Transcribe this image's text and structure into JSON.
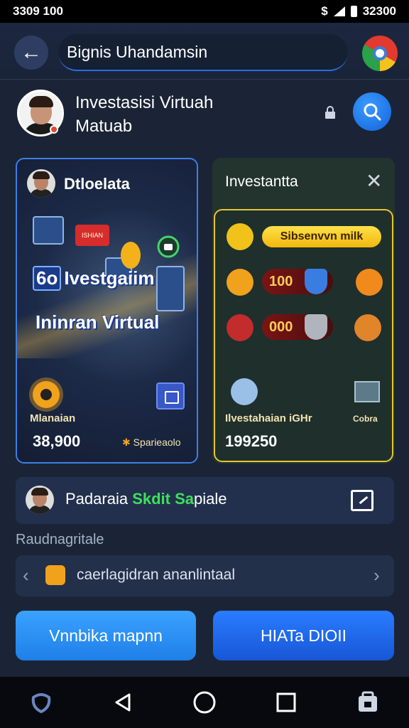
{
  "status_bar": {
    "time": "3309 100",
    "right_text": "32300"
  },
  "header": {
    "title": "Bignis Uhandamsin",
    "back_icon": "arrow-left-icon",
    "browser_icon": "chrome-icon"
  },
  "profile": {
    "title": "Investasisi Virtuah Matuab",
    "lock_icon": "lock-icon",
    "search_icon": "search-icon"
  },
  "card_left": {
    "title": "Dtloelata",
    "tag_text": "ISHIAN",
    "promo_line1": "Ivestgaiim",
    "promo_prefix": "6o",
    "promo_line2": "Ininran Virtual",
    "label": "Mlanaian",
    "value": "38,900",
    "secondary": "Sparieaolo"
  },
  "card_right": {
    "title": "Investantta",
    "pill_text": "Sibsenvvn milk",
    "row2_value": "100",
    "row3_value": "000",
    "label": "Ilvestahaian iGHr",
    "side_label": "Cobra",
    "value": "199250"
  },
  "promo": {
    "prefix": "Padaraia",
    "green_text": "Skdit",
    "green_text2": "Sa",
    "suffix": "piale"
  },
  "section_label": "Raudnagritale",
  "carousel": {
    "text": "caerlagidran ananlintaal"
  },
  "buttons": {
    "left": "Vnnbika mapnn",
    "right": "HIATa DIOII"
  },
  "accent_colors": {
    "blue": "#2a7cff",
    "gold": "#e6c52e",
    "green": "#3de05a"
  }
}
